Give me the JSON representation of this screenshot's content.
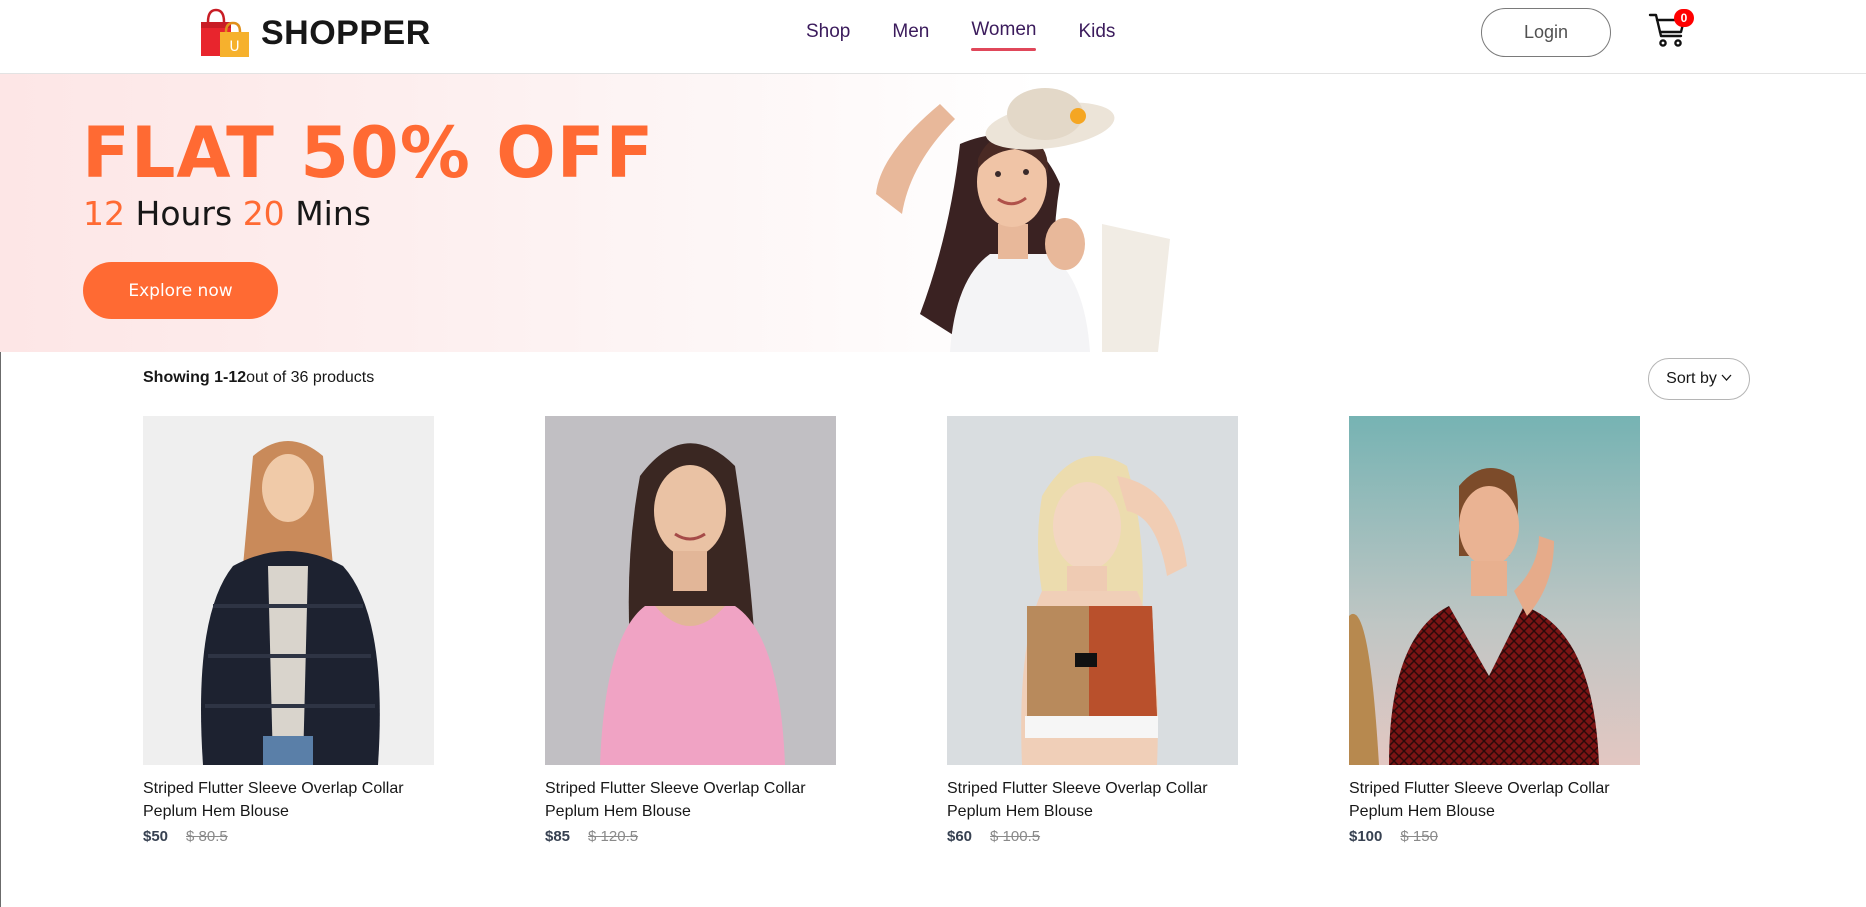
{
  "brand": {
    "name": "SHOPPER",
    "logo_letter": "U",
    "icon": "shopping-bag-icon"
  },
  "nav": {
    "items": [
      {
        "label": "Shop",
        "active": false
      },
      {
        "label": "Men",
        "active": false
      },
      {
        "label": "Women",
        "active": true
      },
      {
        "label": "Kids",
        "active": false
      }
    ],
    "login_label": "Login",
    "cart_count": "0",
    "cart_icon": "cart-icon"
  },
  "hero": {
    "title": "FLAT 50% OFF",
    "timer": {
      "hours": "12",
      "hours_label": "Hours",
      "mins": "20",
      "mins_label": "Mins"
    },
    "cta_label": "Explore now"
  },
  "listing": {
    "showing_bold": "Showing 1-12",
    "showing_rest": "out of 36 products",
    "sort_label": "Sort by",
    "sort_icon": "chevron-down-icon"
  },
  "products": [
    {
      "name": "Striped Flutter Sleeve Overlap Collar Peplum Hem Blouse",
      "new_price": "$50",
      "old_price": "$ 80.5"
    },
    {
      "name": "Striped Flutter Sleeve Overlap Collar Peplum Hem Blouse",
      "new_price": "$85",
      "old_price": "$ 120.5"
    },
    {
      "name": "Striped Flutter Sleeve Overlap Collar Peplum Hem Blouse",
      "new_price": "$60",
      "old_price": "$ 100.5"
    },
    {
      "name": "Striped Flutter Sleeve Overlap Collar Peplum Hem Blouse",
      "new_price": "$100",
      "old_price": "$ 150"
    }
  ],
  "colors": {
    "accent": "#ff6a33",
    "nav_text": "#3b1b5c",
    "nav_underline": "#e0475a",
    "badge": "#ff0000"
  }
}
